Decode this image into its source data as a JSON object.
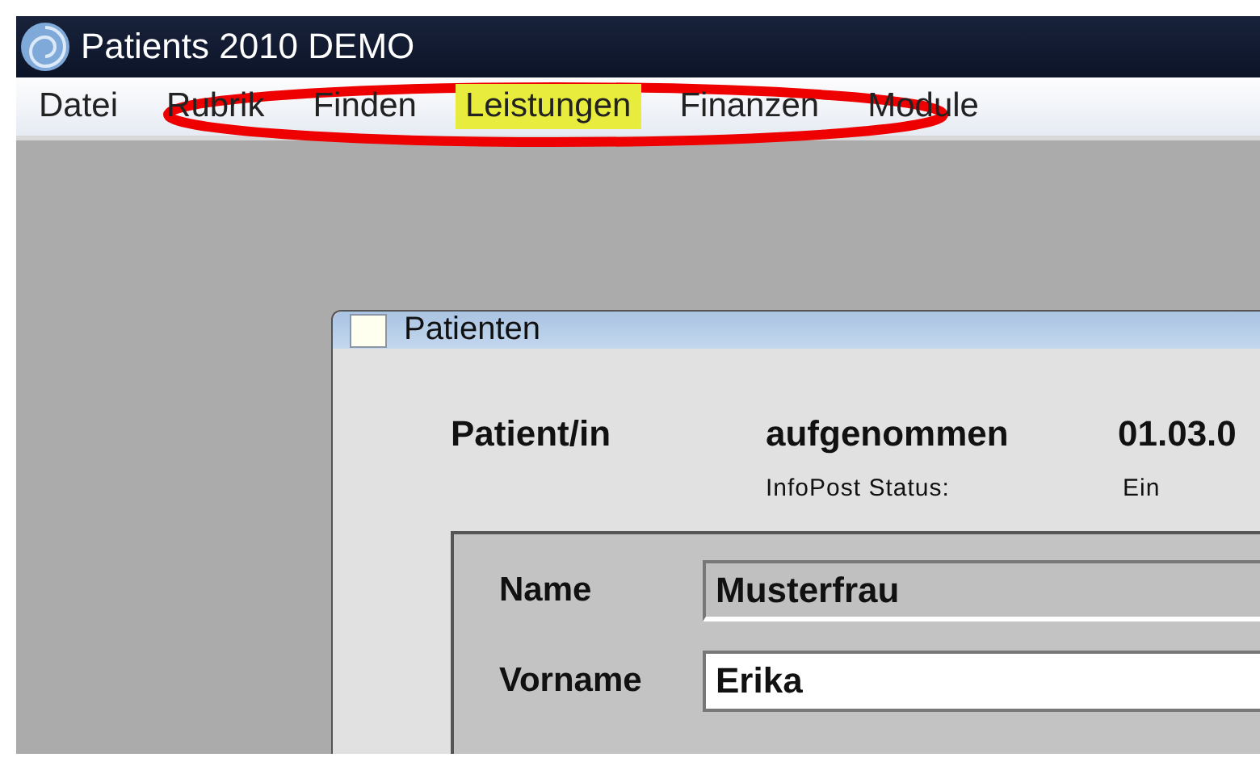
{
  "window": {
    "title": "Patients 2010 DEMO"
  },
  "menu": [
    {
      "label": "Datei",
      "selected": false
    },
    {
      "label": "Rubrik",
      "selected": false
    },
    {
      "label": "Finden",
      "selected": false
    },
    {
      "label": "Leistungen",
      "selected": true
    },
    {
      "label": "Finanzen",
      "selected": false
    },
    {
      "label": "Module",
      "selected": false
    }
  ],
  "annotation": {
    "kind": "ellipse",
    "color": "#ee0000"
  },
  "dialog": {
    "title": "Patienten",
    "heading": "Patient/in",
    "status": "aufgenommen",
    "date": "01.03.0",
    "infopost_label": "InfoPost Status:",
    "infopost_value": "Ein",
    "fields": [
      {
        "label": "Name",
        "value": "Musterfrau",
        "disabled": true
      },
      {
        "label": "Vorname",
        "value": "Erika",
        "disabled": false
      }
    ]
  }
}
